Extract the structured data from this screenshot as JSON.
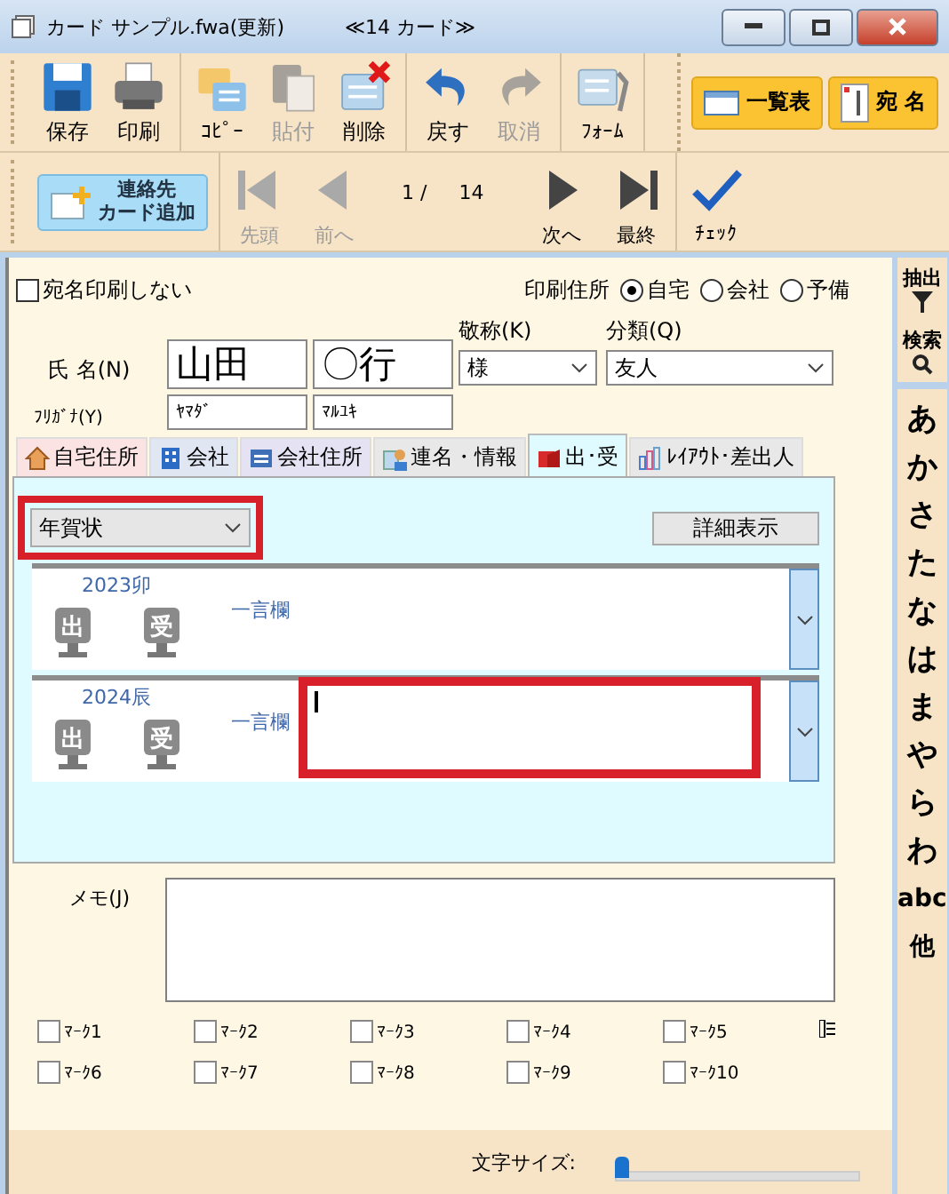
{
  "window": {
    "title": "カード サンプル.fwa(更新)",
    "card_count": "≪14 カード≫"
  },
  "toolbar": [
    {
      "label": "保存",
      "kind": "save",
      "disabled": false
    },
    {
      "label": "印刷",
      "kind": "print",
      "disabled": false
    },
    {
      "label": "ｺﾋﾟｰ",
      "kind": "copy",
      "disabled": false
    },
    {
      "label": "貼付",
      "kind": "paste",
      "disabled": true
    },
    {
      "label": "削除",
      "kind": "delete",
      "disabled": false
    },
    {
      "label": "戻す",
      "kind": "undo",
      "disabled": false
    },
    {
      "label": "取消",
      "kind": "redo",
      "disabled": true
    },
    {
      "label": "ﾌｫｰﾑ",
      "kind": "form",
      "disabled": false
    }
  ],
  "view_buttons": [
    {
      "label": "一覧表",
      "kind": "table"
    },
    {
      "label": "宛 名",
      "kind": "address"
    }
  ],
  "nav": {
    "add_button": [
      "連絡先",
      "カード追加"
    ],
    "buttons": [
      {
        "label": "先頭",
        "kind": "first",
        "disabled": true
      },
      {
        "label": "前へ",
        "kind": "prev",
        "disabled": true
      },
      {
        "label": "次へ",
        "kind": "next",
        "disabled": false
      },
      {
        "label": "最終",
        "kind": "last",
        "disabled": false
      }
    ],
    "page": "1 /",
    "total": "14",
    "check": "ﾁｪｯｸ"
  },
  "form": {
    "no_print": {
      "label": "宛名印刷しない",
      "checked": false
    },
    "print_address": {
      "label": "印刷住所",
      "options": [
        {
          "label": "自宅",
          "selected": true
        },
        {
          "label": "会社",
          "selected": false
        },
        {
          "label": "予備",
          "selected": false
        }
      ]
    },
    "name_label": "氏 名(N)",
    "name": [
      "山田",
      "〇行"
    ],
    "furigana_label": "ﾌﾘｶﾞﾅ(Y)",
    "furigana": [
      "ﾔﾏﾀﾞ",
      "ﾏﾙﾕｷ"
    ],
    "honorific": {
      "label": "敬称(K)",
      "value": "様"
    },
    "category": {
      "label": "分類(Q)",
      "value": "友人"
    }
  },
  "tabs": [
    {
      "label": "自宅住所",
      "kind": "home",
      "color": "#fbe3e3",
      "selected": false
    },
    {
      "label": "会社",
      "kind": "building",
      "color": "#e1e6f3",
      "selected": false
    },
    {
      "label": "会社住所",
      "kind": "card",
      "color": "#e4e2f3",
      "selected": false
    },
    {
      "label": "連名・情報",
      "kind": "people",
      "color": "#e8e8e8",
      "selected": false
    },
    {
      "label": "出･受",
      "kind": "post",
      "color": "#e0fbff",
      "selected": true
    },
    {
      "label": "ﾚｲｱｳﾄ･差出人",
      "kind": "chart",
      "color": "#e8e8e8",
      "selected": false
    }
  ],
  "greetings": {
    "type": {
      "value": "年賀状",
      "highlighted": true
    },
    "detail_button": "詳細表示",
    "years": [
      {
        "year": "2023卯",
        "sent": "出",
        "received": "受",
        "comment_label": "一言欄",
        "editing": false
      },
      {
        "year": "2024辰",
        "sent": "出",
        "received": "受",
        "comment_label": "一言欄",
        "editing": true
      }
    ]
  },
  "memo_label": "メモ(J)",
  "marks": [
    {
      "label": "ﾏｰｸ1",
      "checked": false
    },
    {
      "label": "ﾏｰｸ2",
      "checked": false
    },
    {
      "label": "ﾏｰｸ3",
      "checked": false
    },
    {
      "label": "ﾏｰｸ4",
      "checked": false
    },
    {
      "label": "ﾏｰｸ5",
      "checked": false
    },
    {
      "label": "ﾏｰｸ6",
      "checked": false
    },
    {
      "label": "ﾏｰｸ7",
      "checked": false
    },
    {
      "label": "ﾏｰｸ8",
      "checked": false
    },
    {
      "label": "ﾏｰｸ9",
      "checked": false
    },
    {
      "label": "ﾏｰｸ10",
      "checked": false
    }
  ],
  "font_size": {
    "label": "文字サイズ:",
    "level": 0
  },
  "index": {
    "tools": [
      {
        "label": "抽出",
        "kind": "filter"
      },
      {
        "label": "検索",
        "kind": "search"
      }
    ],
    "kana": [
      "あ",
      "か",
      "さ",
      "た",
      "な",
      "は",
      "ま",
      "や",
      "ら",
      "わ",
      "abc",
      "他"
    ]
  }
}
